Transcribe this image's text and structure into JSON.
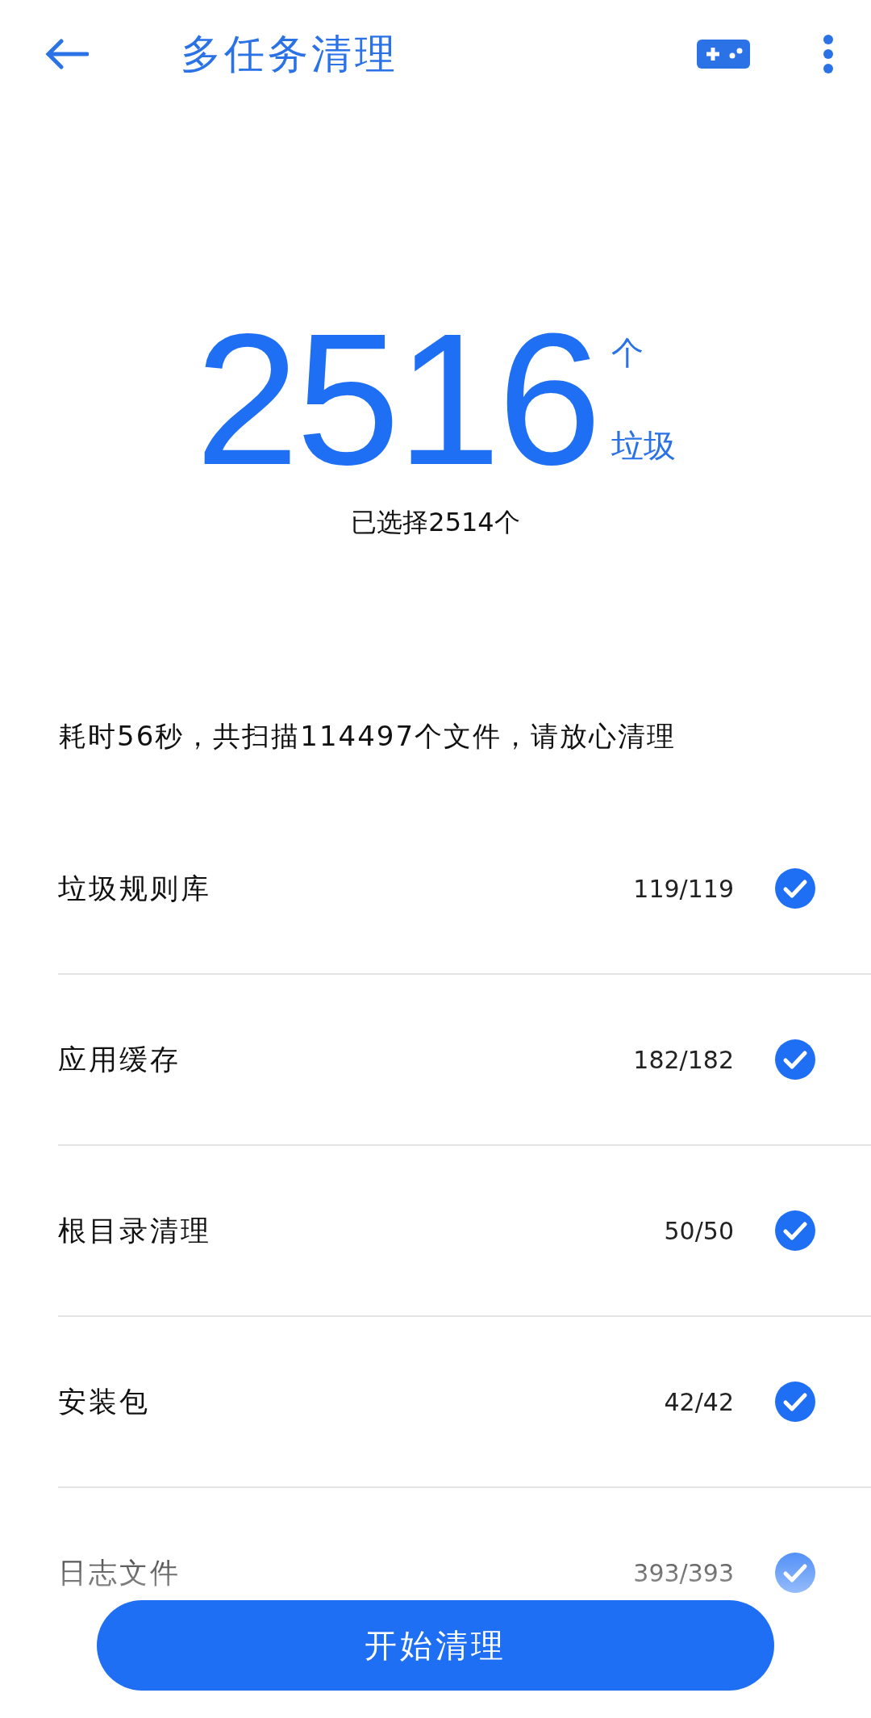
{
  "header": {
    "title": "多任务清理"
  },
  "summary": {
    "count": "2516",
    "unit": "个",
    "label": "垃圾",
    "selected_text": "已选择2514个"
  },
  "scan_info": "耗时56秒，共扫描114497个文件，请放心清理",
  "items": [
    {
      "name": "垃圾规则库",
      "count": "119/119",
      "checked": true
    },
    {
      "name": "应用缓存",
      "count": "182/182",
      "checked": true
    },
    {
      "name": "根目录清理",
      "count": "50/50",
      "checked": true
    },
    {
      "name": "安装包",
      "count": "42/42",
      "checked": true
    },
    {
      "name": "日志文件",
      "count": "393/393",
      "checked": true
    }
  ],
  "action_button": "开始清理"
}
